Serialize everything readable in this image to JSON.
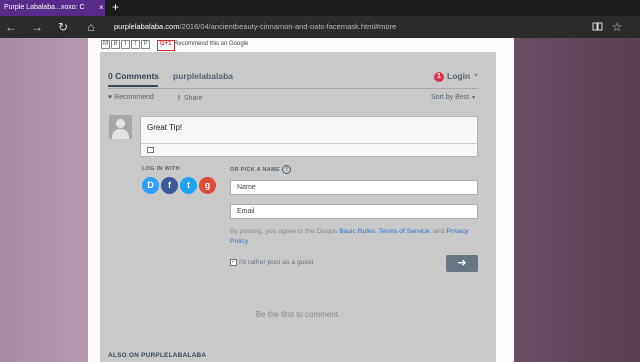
{
  "browser": {
    "tab_title": "Purple Labalaba...xoxo: C",
    "tab_close": "×",
    "new_tab": "+",
    "back": "←",
    "forward": "→",
    "refresh": "↻",
    "home": "⌂",
    "url_domain": "purplelabalaba.com",
    "url_path": "/2016/04/ancientbeauty-cinnamon-and-oats-facemask.html#more",
    "reading_icon": "reading-view-icon",
    "favorite_icon": "favorite-star-icon"
  },
  "share_bar": {
    "icons": [
      "M",
      "B",
      "t",
      "f",
      "P"
    ],
    "gplus_label": "G+1",
    "recommend_google": "Recommend this on Google"
  },
  "disqus": {
    "comments_count": "0 Comments",
    "forum_name": "purplelabalaba",
    "login_badge": "1",
    "login_label": "Login",
    "recommend": "Recommend",
    "share": "Share",
    "sort": "Sort by Best",
    "comment_text": "Great Tip!",
    "login_with": "LOG IN WITH",
    "social": [
      "D",
      "f",
      "t",
      "g"
    ],
    "pick_name": "OR PICK A NAME",
    "help": "?",
    "name_placeholder": "Name",
    "email_placeholder": "Email",
    "terms_prefix": "By posting, you agree to the Disqus ",
    "terms_link1": "Basic Rules",
    "terms_sep": ", ",
    "terms_link2": "Terms of Service",
    "terms_and": ", and ",
    "terms_link3": "Privacy Policy",
    "guest_label": "I'd rather post as a guest",
    "submit_arrow": "➜",
    "empty_message": "Be the first to comment.",
    "also_on": "ALSO ON PURPLELABALABA"
  },
  "colors": {
    "tab_active": "#5a2a8a",
    "disqus_bg": "#c9c9c9",
    "link": "#2e75c4",
    "badge": "#e0334a"
  }
}
